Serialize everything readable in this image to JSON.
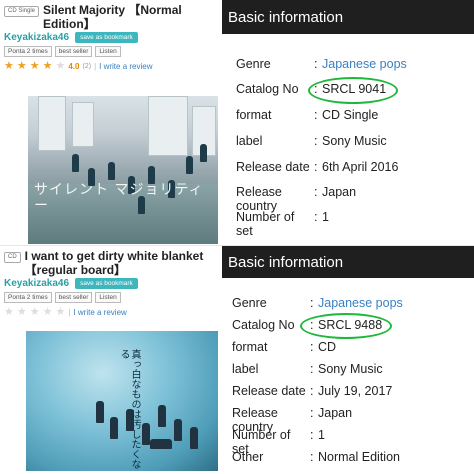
{
  "product1": {
    "tag": "CD Single",
    "title": "Silent Majority 【Normal Edition】",
    "artist": "Keyakizaka46",
    "bookmark_label": "save as bookmark",
    "badges": [
      "Ponta 2 times",
      "best seller",
      "Listen"
    ],
    "rating": "4.0",
    "rating_count": "(2)",
    "stars_on": 4,
    "review_link": "I write a review",
    "cover_text": "サイレント マジョリティー"
  },
  "product2": {
    "tag": "CD",
    "title": "I want to get dirty white blanket 【regular board】",
    "artist": "Keyakizaka46",
    "bookmark_label": "save as bookmark",
    "badges": [
      "Ponta 2 times",
      "best seller",
      "Listen"
    ],
    "review_link": "I write a review",
    "cover_text": "真っ白なものは汚したくなる"
  },
  "info1": {
    "header": "Basic information",
    "rows": [
      {
        "key": "Genre",
        "value": "Japanese pops",
        "link": true
      },
      {
        "key": "Catalog No",
        "value": "SRCL 9041",
        "link": false
      },
      {
        "key": "format",
        "value": "CD Single",
        "link": false
      },
      {
        "key": "label",
        "value": "Sony Music",
        "link": false
      },
      {
        "key": "Release date",
        "value": "6th April 2016",
        "link": false
      },
      {
        "key": "Release country",
        "value": "Japan",
        "link": false
      },
      {
        "key": "Number of set",
        "value": "1",
        "link": false
      }
    ]
  },
  "info2": {
    "header": "Basic information",
    "rows": [
      {
        "key": "Genre",
        "value": "Japanese pops",
        "link": true
      },
      {
        "key": "Catalog No",
        "value": "SRCL 9488",
        "link": false
      },
      {
        "key": "format",
        "value": "CD",
        "link": false
      },
      {
        "key": "label",
        "value": "Sony Music",
        "link": false
      },
      {
        "key": "Release date",
        "value": "July 19, 2017",
        "link": false
      },
      {
        "key": "Release country",
        "value": "Japan",
        "link": false
      },
      {
        "key": "Number of set",
        "value": "1",
        "link": false
      },
      {
        "key": "Other",
        "value": "Normal Edition",
        "link": false
      }
    ]
  },
  "colors": {
    "accent_teal": "#3db6bd",
    "link_blue": "#3a80c4",
    "highlight_ring": "#1fb83a",
    "header_bg": "#1f1f1f"
  }
}
